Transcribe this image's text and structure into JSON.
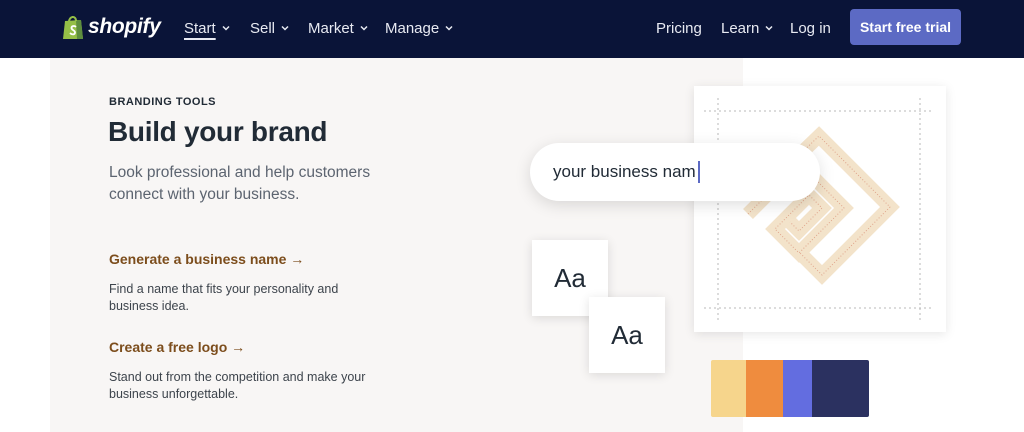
{
  "nav": {
    "brand": "shopify",
    "items": [
      {
        "label": "Start",
        "active": true
      },
      {
        "label": "Sell"
      },
      {
        "label": "Market"
      },
      {
        "label": "Manage"
      }
    ],
    "pricing": "Pricing",
    "learn": "Learn",
    "login": "Log in",
    "cta": "Start free trial"
  },
  "hero": {
    "eyebrow": "BRANDING TOOLS",
    "title": "Build your brand",
    "subtitle": "Look professional and help customers connect with your business."
  },
  "tools": [
    {
      "link": "Generate a business name →",
      "desc": "Find a name that fits your personality and business idea."
    },
    {
      "link": "Create a free logo →",
      "desc": "Stand out from the competition and make your business unforgettable."
    }
  ],
  "illustration": {
    "business_name_input": "your business nam",
    "font_sample_1": "Aa",
    "font_sample_2": "Aa",
    "swatches": [
      "#f6d58c",
      "#ef8c3e",
      "#636de0",
      "#2b3160"
    ]
  },
  "colors": {
    "nav_bg": "#0a1438",
    "cta_bg": "#5c6ac4",
    "link_brown": "#7c4d1c"
  }
}
